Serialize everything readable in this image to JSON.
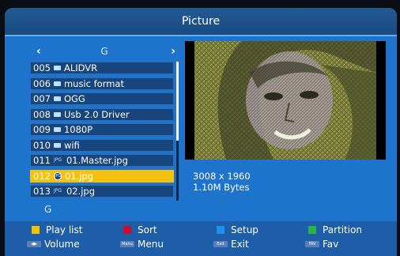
{
  "title": "Picture",
  "nav": {
    "left_arrow": "‹",
    "folder": "G",
    "right_arrow": "›"
  },
  "list": [
    {
      "num": "005",
      "icon": "folder-icon",
      "name": "ALIDVR"
    },
    {
      "num": "006",
      "icon": "folder-icon",
      "name": "music format"
    },
    {
      "num": "007",
      "icon": "folder-icon",
      "name": "OGG"
    },
    {
      "num": "008",
      "icon": "folder-icon",
      "name": "Usb 2.0 Driver"
    },
    {
      "num": "009",
      "icon": "folder-icon",
      "name": "1080P"
    },
    {
      "num": "010",
      "icon": "folder-icon",
      "name": "wifi"
    },
    {
      "num": "011",
      "icon": "jpg-file-icon",
      "icon_text": "JPG",
      "name": "01.Master.jpg"
    },
    {
      "num": "012",
      "icon": "disc-icon",
      "icon_text": "JPG",
      "name": "01.jpg",
      "selected": true
    },
    {
      "num": "013",
      "icon": "jpg-file-icon",
      "icon_text": "JPG",
      "name": "02.jpg"
    }
  ],
  "current_drive": "G",
  "info": {
    "resolution": "3008 x 1960",
    "size": "1.10M Bytes"
  },
  "legend": [
    {
      "color": "#f2c200",
      "label": "Play list"
    },
    {
      "color": "#c8102e",
      "label": "Sort"
    },
    {
      "color": "#1e8ef0",
      "label": "Setup"
    },
    {
      "color": "#29b34a",
      "label": "Partition"
    }
  ],
  "keys": [
    {
      "key": "◀▶",
      "label": "Volume"
    },
    {
      "key": "Menu",
      "label": "Menu"
    },
    {
      "key": "Exit",
      "label": "Exit"
    },
    {
      "key": "FAV",
      "label": "Fav"
    }
  ]
}
